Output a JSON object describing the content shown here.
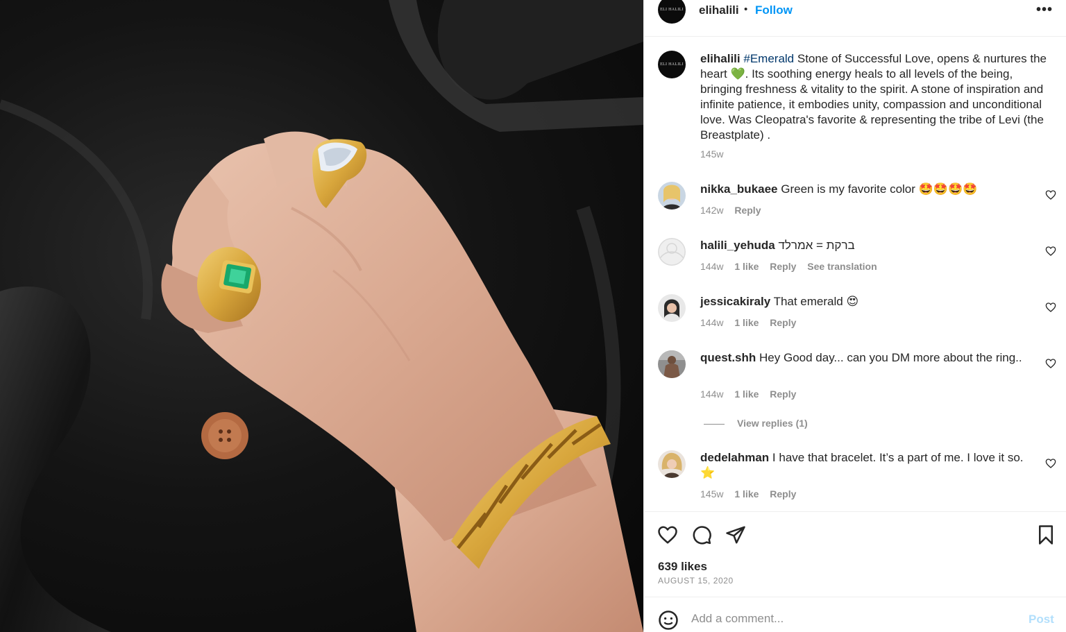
{
  "post": {
    "username": "elihalili",
    "separator": "•",
    "follow_label": "Follow",
    "more_label": "•••",
    "avatar_text": "ELI HALILI",
    "photo_alt": "Hand wearing gold rings and a gold link bracelet on black satin"
  },
  "caption": {
    "username": "elihalili",
    "hashtag": "#Emerald",
    "text": " Stone of Successful Love, opens & nurtures the heart 💚. Its soothing energy heals to all levels of the being, bringing freshness & vitality to the spirit. A stone of inspiration and infinite patience, it embodies unity, compassion and unconditional love. Was Cleopatra's favorite & representing the tribe of Levi (the Breastplate) .",
    "time": "145w"
  },
  "comments": [
    {
      "username": "nikka_bukaee",
      "text": " Green is my favorite color 🤩🤩🤩🤩",
      "time": "142w",
      "likes": "",
      "reply": "Reply",
      "extra": ""
    },
    {
      "username": "halili_yehuda",
      "text": " ברקת = אמרלד",
      "time": "144w",
      "likes": "1 like",
      "reply": "Reply",
      "extra": "See translation"
    },
    {
      "username": "jessicakiraly",
      "text": " That emerald 😍",
      "time": "144w",
      "likes": "1 like",
      "reply": "Reply",
      "extra": ""
    },
    {
      "username": "quest.shh",
      "text": " Hey Good day... can you DM more about the ring..",
      "time": "144w",
      "likes": "1 like",
      "reply": "Reply",
      "extra": ""
    },
    {
      "username": "dedelahman",
      "text": " I have that bracelet. It’s a part of me. I love it so. ⭐",
      "time": "145w",
      "likes": "1 like",
      "reply": "Reply",
      "extra": ""
    }
  ],
  "view_replies": "View replies (1)",
  "actions": {
    "likes": "639 likes",
    "date": "AUGUST 15, 2020"
  },
  "add_comment": {
    "placeholder": "Add a comment...",
    "post_label": "Post"
  },
  "colors": {
    "link_blue": "#0095f6",
    "hashtag": "#00376b",
    "muted": "#8e8e8e",
    "post_disabled": "#b2dffc"
  },
  "icons": [
    "more-icon",
    "heart-icon",
    "comment-icon",
    "share-icon",
    "bookmark-icon",
    "emoji-icon"
  ]
}
